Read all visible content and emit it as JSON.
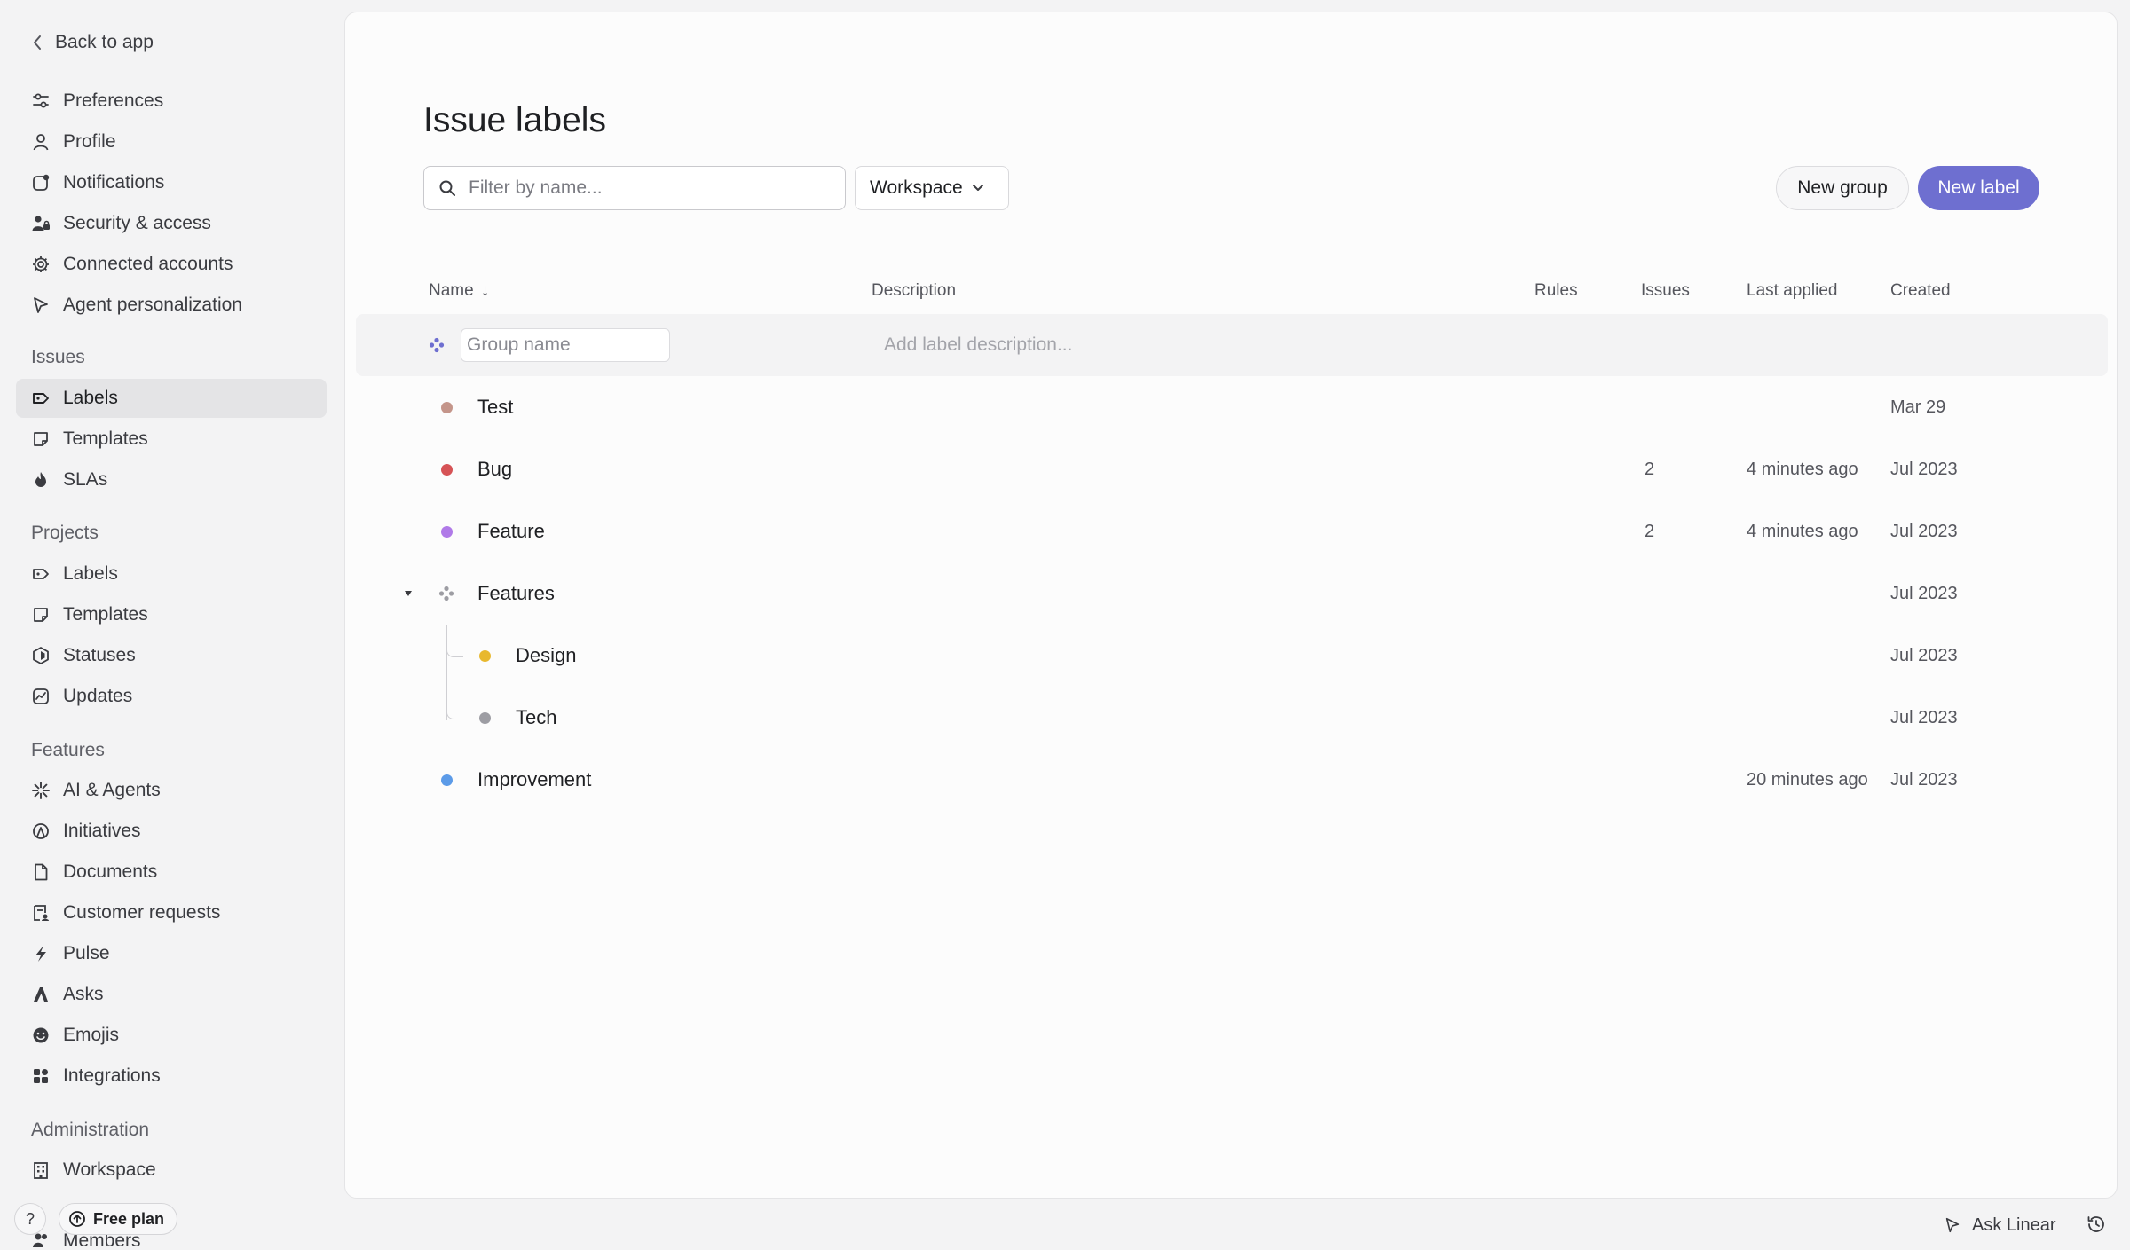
{
  "sidebar": {
    "back_label": "Back to app",
    "account_items": [
      {
        "label": "Preferences",
        "icon": "sliders-icon"
      },
      {
        "label": "Profile",
        "icon": "person-icon"
      },
      {
        "label": "Notifications",
        "icon": "notification-icon"
      },
      {
        "label": "Security & access",
        "icon": "people-lock-icon"
      },
      {
        "label": "Connected accounts",
        "icon": "gear-icon"
      },
      {
        "label": "Agent personalization",
        "icon": "agent-pointer-icon"
      }
    ],
    "sections": [
      {
        "title": "Issues",
        "items": [
          {
            "label": "Labels",
            "icon": "label-tag-icon",
            "active": true
          },
          {
            "label": "Templates",
            "icon": "template-icon"
          },
          {
            "label": "SLAs",
            "icon": "flame-icon"
          }
        ]
      },
      {
        "title": "Projects",
        "items": [
          {
            "label": "Labels",
            "icon": "label-tag-icon"
          },
          {
            "label": "Templates",
            "icon": "template-icon"
          },
          {
            "label": "Statuses",
            "icon": "hexagon-icon"
          },
          {
            "label": "Updates",
            "icon": "chart-line-icon"
          }
        ]
      },
      {
        "title": "Features",
        "items": [
          {
            "label": "AI & Agents",
            "icon": "sparkle-icon"
          },
          {
            "label": "Initiatives",
            "icon": "initiative-icon"
          },
          {
            "label": "Documents",
            "icon": "document-icon"
          },
          {
            "label": "Customer requests",
            "icon": "request-icon"
          },
          {
            "label": "Pulse",
            "icon": "pulse-icon"
          },
          {
            "label": "Asks",
            "icon": "asks-icon"
          },
          {
            "label": "Emojis",
            "icon": "emoji-icon"
          },
          {
            "label": "Integrations",
            "icon": "integrations-icon"
          }
        ]
      },
      {
        "title": "Administration",
        "items": [
          {
            "label": "Workspace",
            "icon": "building-icon"
          },
          {
            "label": "Members",
            "icon": "members-icon"
          }
        ]
      }
    ],
    "help_label": "?",
    "plan_label": "Free plan"
  },
  "main": {
    "title": "Issue labels",
    "filter": {
      "placeholder": "Filter by name...",
      "value": ""
    },
    "scope_select": {
      "value": "Workspace"
    },
    "new_group_label": "New group",
    "new_label_label": "New label",
    "accent_color": "#6e6fd0",
    "table": {
      "headers": {
        "name": "Name",
        "sort_indicator": "↓",
        "description": "Description",
        "rules": "Rules",
        "issues": "Issues",
        "last_applied": "Last applied",
        "created": "Created"
      },
      "new_group_row": {
        "name_placeholder": "Group name",
        "description_placeholder": "Add label description..."
      },
      "rows": [
        {
          "name": "Test",
          "color": "#c4958a",
          "issues": "",
          "last_applied": "",
          "created": "Mar 29"
        },
        {
          "name": "Bug",
          "color": "#d65356",
          "issues": "2",
          "last_applied": "4 minutes ago",
          "created": "Jul 2023"
        },
        {
          "name": "Feature",
          "color": "#b07ae8",
          "issues": "2",
          "last_applied": "4 minutes ago",
          "created": "Jul 2023"
        },
        {
          "name": "Features",
          "is_group": true,
          "expanded": true,
          "created": "Jul 2023"
        },
        {
          "name": "Design",
          "color": "#e8b82e",
          "child": true,
          "created": "Jul 2023"
        },
        {
          "name": "Tech",
          "color": "#9d9da3",
          "child": true,
          "created": "Jul 2023"
        },
        {
          "name": "Improvement",
          "color": "#5c9be8",
          "issues": "",
          "last_applied": "20 minutes ago",
          "created": "Jul 2023"
        }
      ]
    }
  },
  "footer": {
    "ask_label": "Ask Linear"
  }
}
